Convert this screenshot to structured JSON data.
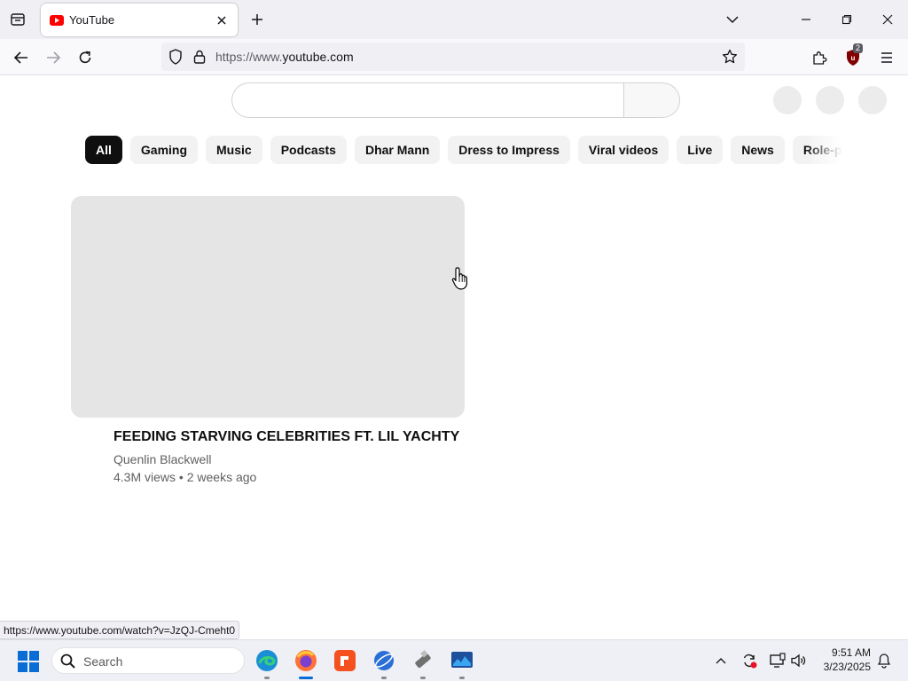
{
  "browser": {
    "tab": {
      "title": "YouTube"
    },
    "url": {
      "prefix": "https://www.",
      "domain": "youtube.com"
    },
    "extension_badge": "2",
    "status_url": "https://www.youtube.com/watch?v=JzQJ-Cmeht0"
  },
  "youtube": {
    "chips": [
      {
        "label": "All",
        "active": true
      },
      {
        "label": "Gaming"
      },
      {
        "label": "Music"
      },
      {
        "label": "Podcasts"
      },
      {
        "label": "Dhar Mann"
      },
      {
        "label": "Dress to Impress"
      },
      {
        "label": "Viral videos"
      },
      {
        "label": "Live"
      },
      {
        "label": "News"
      },
      {
        "label": "Role-playing games"
      }
    ],
    "video": {
      "title": "FEEDING STARVING CELEBRITIES FT. LIL YACHTY",
      "channel": "Quenlin Blackwell",
      "views": "4.3M views",
      "separator": "•",
      "age": "2 weeks ago"
    }
  },
  "taskbar": {
    "search_label": "Search",
    "time": "9:51 AM",
    "date": "3/23/2025"
  },
  "colors": {
    "youtube_red": "#ff0000",
    "chip_active": "#0f0f0f",
    "chip_bg": "#f2f2f2",
    "windows_blue": "#0a6dd6"
  }
}
